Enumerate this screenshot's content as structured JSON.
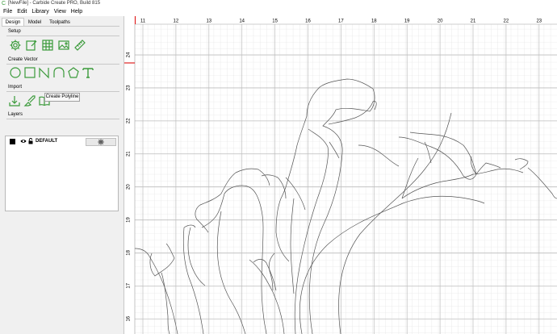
{
  "window": {
    "title": "[NewFile] - Carbide Create PRO, Build 815"
  },
  "menu": [
    "File",
    "Edit",
    "Library",
    "View",
    "Help"
  ],
  "tabs": [
    "Design",
    "Model",
    "Toolpaths"
  ],
  "sections": {
    "setup": "Setup",
    "create_vector": "Create Vector",
    "import": "Import",
    "layers": "Layers"
  },
  "setup_icons": [
    "gear-icon",
    "document-edit-icon",
    "grid-icon",
    "image-icon",
    "ruler-icon"
  ],
  "create_vector_icons": [
    "circle-icon",
    "rectangle-icon",
    "polyline-icon",
    "curve-icon",
    "polygon-icon",
    "text-icon"
  ],
  "import_icons": [
    "import-file-icon",
    "import-shapes-icon",
    "library-book-icon"
  ],
  "tooltip": "Create Polyline",
  "layers": [
    {
      "name": "DEFAULT",
      "color": "#000000"
    }
  ],
  "ruler": {
    "x_labels": [
      "11",
      "12",
      "13",
      "14",
      "15",
      "16",
      "17",
      "18",
      "19",
      "20",
      "21",
      "22",
      "23"
    ],
    "y_labels": [
      "24",
      "23",
      "22",
      "21",
      "20",
      "19",
      "18",
      "17",
      "16"
    ]
  },
  "colors": {
    "accent": "#3a9a3a",
    "grid": "#d8d8d8",
    "origin_marker": "#e02020"
  }
}
